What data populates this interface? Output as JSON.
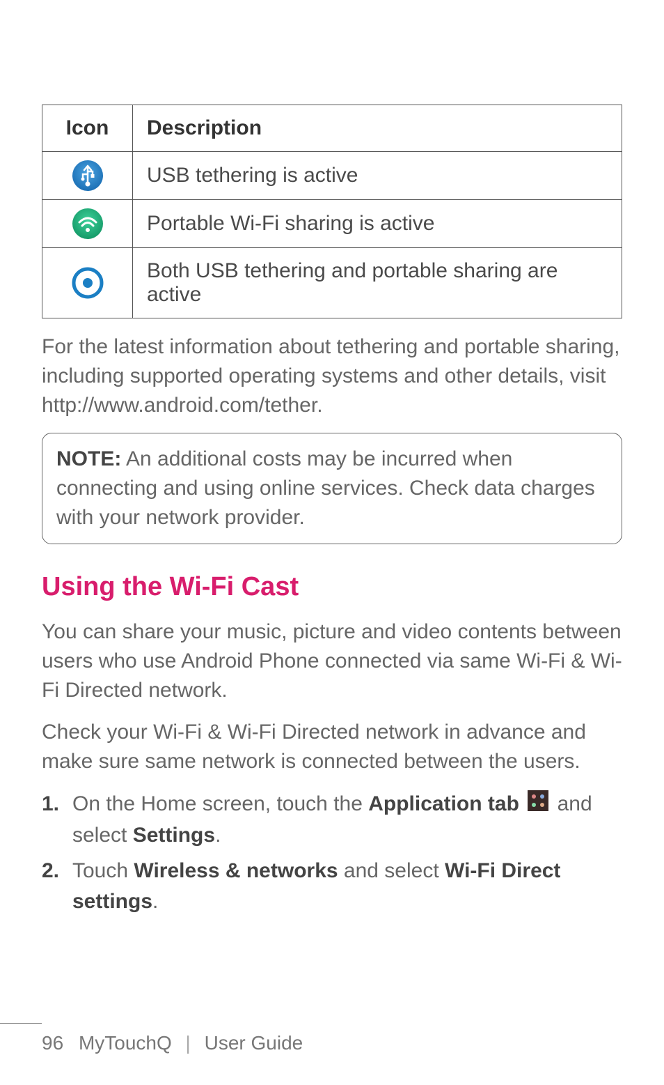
{
  "table": {
    "headers": {
      "icon": "Icon",
      "description": "Description"
    },
    "rows": [
      {
        "icon_name": "usb-tether-icon",
        "description": "USB tethering is active"
      },
      {
        "icon_name": "wifi-share-icon",
        "description": "Portable Wi-Fi sharing is active"
      },
      {
        "icon_name": "both-active-icon",
        "description": "Both USB tethering and portable sharing are active"
      }
    ]
  },
  "paragraphs": {
    "after_table": "For the latest information about tethering and portable sharing, including supported operating systems and other details, visit http://www.android.com/tether."
  },
  "note": {
    "prefix": "NOTE:",
    "body": " An additional costs may be incurred when connecting and using online services. Check data charges with your network provider."
  },
  "section": {
    "heading": "Using the Wi-Fi Cast",
    "intro1": "You can share your music, picture and video contents between users who use Android Phone connected via same Wi-Fi & Wi-Fi Directed network.",
    "intro2": "Check your Wi-Fi & Wi-Fi Directed network in advance and make sure same network is connected between the users."
  },
  "steps": [
    {
      "num": "1.",
      "parts": {
        "a": "On the Home screen, touch the ",
        "bold1": "Application tab",
        "b": " and select ",
        "bold2": "Settings",
        "c": "."
      },
      "inline_icon": "apps-icon"
    },
    {
      "num": "2.",
      "parts": {
        "a": "Touch ",
        "bold1": "Wireless & networks",
        "b": " and select ",
        "bold2": "Wi-Fi Direct settings",
        "c": "."
      }
    }
  ],
  "footer": {
    "page": "96",
    "product": "MyTouchQ",
    "sep": "|",
    "doc": "User Guide"
  }
}
